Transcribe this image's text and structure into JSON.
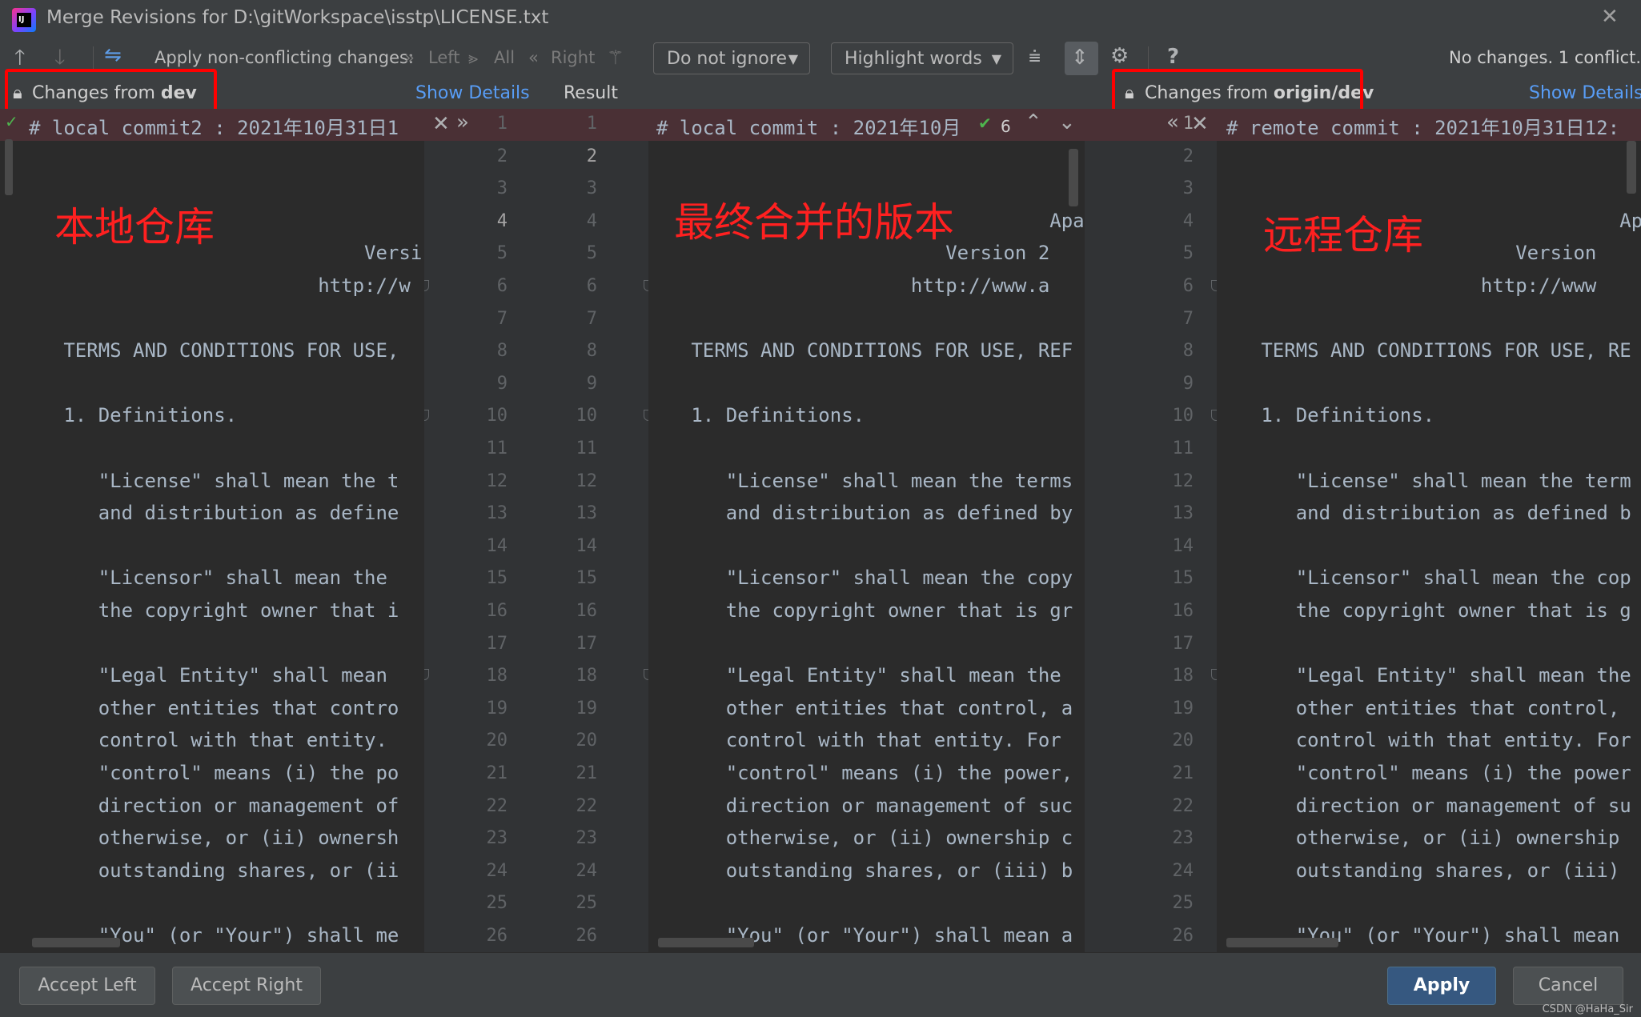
{
  "window": {
    "title": "Merge Revisions for D:\\gitWorkspace\\isstp\\LICENSE.txt",
    "logo_text": "IJ"
  },
  "toolbar": {
    "apply_label": "Apply non-conflicting changes:",
    "left": "Left",
    "all": "All",
    "right": "Right",
    "ignore_select": "Do not ignore",
    "highlight_select": "Highlight words",
    "status": "No changes. 1 conflict.",
    "help": "?"
  },
  "headers": {
    "left_prefix": "Changes from ",
    "left_branch": "dev",
    "left_details": "Show Details",
    "result": "Result",
    "right_prefix": "Changes from ",
    "right_branch": "origin/dev",
    "right_details": "Show Details",
    "change_count": "6"
  },
  "annotations": {
    "left": "本地仓库",
    "center": "最终合并的版本",
    "right": "远程仓库"
  },
  "editors": {
    "left": [
      "# local commit2 : 2021年10月31日1",
      "",
      "",
      "",
      "                             Versi",
      "                         http://w",
      "",
      "   TERMS AND CONDITIONS FOR USE,",
      "",
      "   1. Definitions.",
      "",
      "      \"License\" shall mean the t",
      "      and distribution as define",
      "",
      "      \"Licensor\" shall mean the",
      "      the copyright owner that i",
      "",
      "      \"Legal Entity\" shall mean",
      "      other entities that contro",
      "      control with that entity.",
      "      \"control\" means (i) the po",
      "      direction or management of",
      "      otherwise, or (ii) ownersh",
      "      outstanding shares, or (ii",
      "",
      "      \"You\" (or \"Your\") shall me"
    ],
    "center": [
      "# local commit : 2021年10月",
      "",
      "",
      "                                  Apa",
      "                         Version 2",
      "                      http://www.a",
      "",
      "   TERMS AND CONDITIONS FOR USE, REF",
      "",
      "   1. Definitions.",
      "",
      "      \"License\" shall mean the terms",
      "      and distribution as defined by",
      "",
      "      \"Licensor\" shall mean the copy",
      "      the copyright owner that is gr",
      "",
      "      \"Legal Entity\" shall mean the",
      "      other entities that control, a",
      "      control with that entity. For",
      "      \"control\" means (i) the power,",
      "      direction or management of suc",
      "      otherwise, or (ii) ownership c",
      "      outstanding shares, or (iii) b",
      "",
      "      \"You\" (or \"Your\") shall mean a"
    ],
    "right": [
      "# remote commit : 2021年10月31日12:",
      "",
      "",
      "                                  Ap",
      "                         Version",
      "                      http://www",
      "",
      "   TERMS AND CONDITIONS FOR USE, RE",
      "",
      "   1. Definitions.",
      "",
      "      \"License\" shall mean the term",
      "      and distribution as defined b",
      "",
      "      \"Licensor\" shall mean the cop",
      "      the copyright owner that is g",
      "",
      "      \"Legal Entity\" shall mean the",
      "      other entities that control,",
      "      control with that entity. For",
      "      \"control\" means (i) the power",
      "      direction or management of su",
      "      otherwise, or (ii) ownership",
      "      outstanding shares, or (iii)",
      "",
      "      \"You\" (or \"Your\") shall mean"
    ]
  },
  "line_numbers": [
    "1",
    "2",
    "3",
    "4",
    "5",
    "6",
    "7",
    "8",
    "9",
    "10",
    "11",
    "12",
    "13",
    "14",
    "15",
    "16",
    "17",
    "18",
    "19",
    "20",
    "21",
    "22",
    "23",
    "24",
    "25",
    "26"
  ],
  "buttons": {
    "accept_left": "Accept Left",
    "accept_right": "Accept Right",
    "apply": "Apply",
    "cancel": "Cancel"
  },
  "watermark": "CSDN @HaHa_Sir",
  "colors": {
    "annotation": "#ff2020",
    "highlight_box": "#ff0000",
    "conflict_band": "#4a3035",
    "link": "#589df6"
  }
}
